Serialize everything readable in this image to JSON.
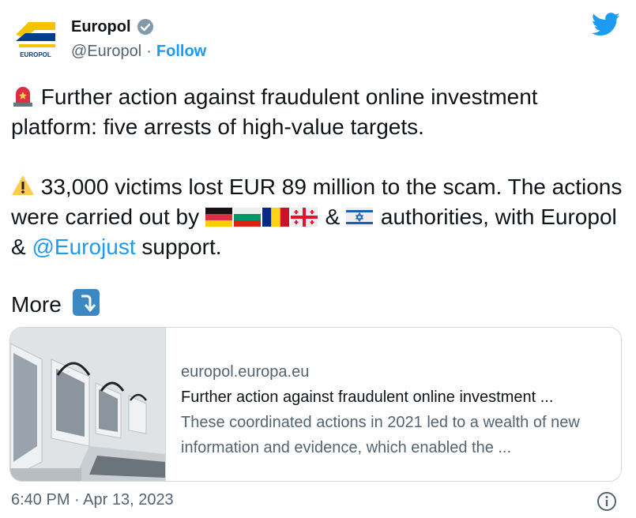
{
  "author": {
    "name": "Europol",
    "handle": "@Europol",
    "follow_label": "Follow",
    "separator": "·",
    "logo_text": "EUROPOL"
  },
  "tweet": {
    "line1_text": " Further action against fraudulent online investment platform: five arrests of high-value targets.",
    "line2_text": " 33,000 victims lost EUR 89 million to the scam. The actions were carried out by ",
    "line2_and": " & ",
    "line2_after": " authorities, with Europol & ",
    "mention": "@Eurojust",
    "line2_end": " support.",
    "more_label": "More",
    "flags": [
      "germany-flag",
      "bulgaria-flag",
      "romania-flag",
      "georgia-flag",
      "israel-flag"
    ]
  },
  "card": {
    "domain": "europol.europa.eu",
    "title": "Further action against fraudulent online investment ...",
    "description": "These coordinated actions in 2021 led to a wealth of new information and evidence, which enabled the ..."
  },
  "footer": {
    "timestamp": "6:40 PM · Apr 13, 2023"
  },
  "colors": {
    "accent": "#1d9bf0",
    "text": "#0f1419",
    "muted": "#536471",
    "border": "#cfd9de"
  }
}
